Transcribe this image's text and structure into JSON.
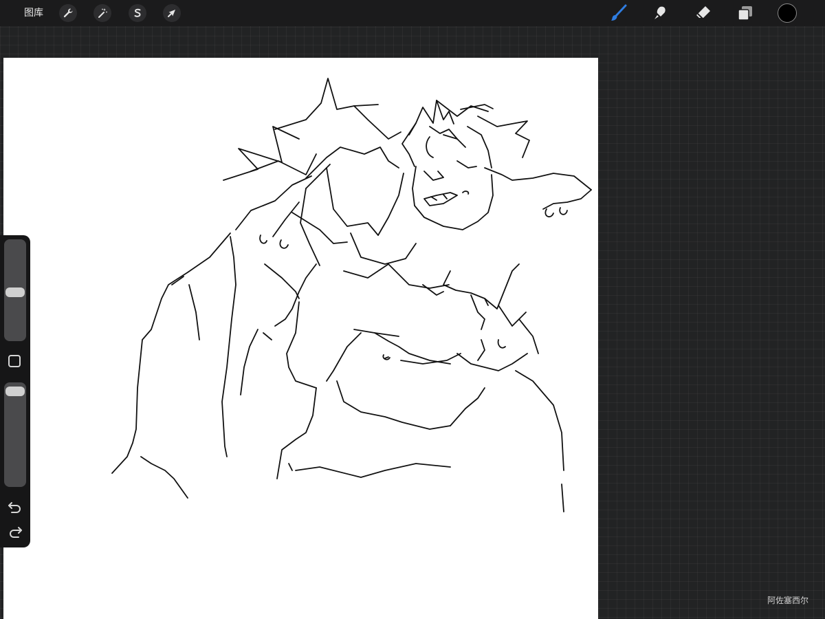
{
  "topbar": {
    "gallery_label": "图库",
    "left_tools": [
      {
        "name": "wrench-icon",
        "action": "actions"
      },
      {
        "name": "magic-wand-icon",
        "action": "adjustments"
      },
      {
        "name": "selection-icon",
        "action": "selection"
      },
      {
        "name": "arrow-cursor-icon",
        "action": "transform"
      }
    ],
    "right_tools": [
      {
        "name": "brush-icon",
        "action": "paint",
        "active": true
      },
      {
        "name": "smudge-icon",
        "action": "smudge",
        "active": false
      },
      {
        "name": "eraser-icon",
        "action": "erase",
        "active": false
      },
      {
        "name": "layers-icon",
        "action": "layers",
        "active": false
      }
    ],
    "current_color": "#000000"
  },
  "sidebar": {
    "brush_size": 0.48,
    "opacity": 0.97,
    "modify_button": "square-icon",
    "undo_icon": "undo-icon",
    "redo_icon": "redo-icon"
  },
  "watermark": "阿佐塞西尔",
  "colors": {
    "active_tool": "#2f7de1",
    "icon": "#e6e6e6",
    "background": "#222324",
    "canvas": "#ffffff",
    "ink": "#111111"
  }
}
